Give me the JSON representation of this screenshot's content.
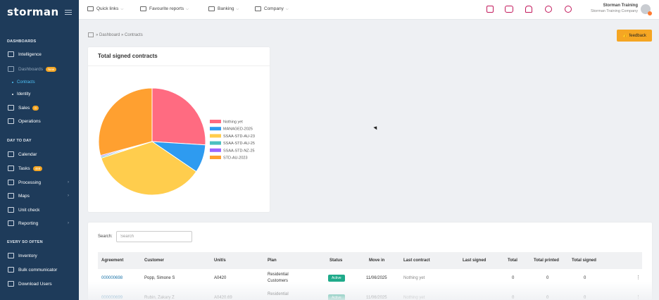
{
  "sidebar": {
    "logo": "storman",
    "sections": {
      "dashboards": "DASHBOARDS",
      "day_to_day": "DAY TO DAY",
      "every_so_often": "EVERY SO OFTEN"
    },
    "items": {
      "intelligence": "Intelligence",
      "dashboards": "Dashboards",
      "dashboards_badge": "New",
      "contracts": "Contracts",
      "identity": "Identity",
      "sales": "Sales",
      "sales_badge": "0",
      "operations": "Operations",
      "calendar": "Calendar",
      "tasks": "Tasks",
      "tasks_badge": "459",
      "processing": "Processing",
      "maps": "Maps",
      "unit_check": "Unit check",
      "reporting": "Reporting",
      "inventory": "Inventory",
      "bulk_communicator": "Bulk communicator",
      "download_users": "Download Users"
    }
  },
  "topbar": {
    "menus": [
      "Quick links",
      "Favourite reports",
      "Banking",
      "Company"
    ],
    "user_name": "Storman Training",
    "user_company": "Storman Training Company"
  },
  "breadcrumb": {
    "dashboard": "Dashboard",
    "contracts": "Contracts"
  },
  "feedback_label": "feedback",
  "chart_card": {
    "title": "Total signed contracts"
  },
  "chart_data": {
    "type": "pie",
    "title": "Total signed contracts",
    "legend_position": "right",
    "slices": [
      {
        "label": "Nothing yet",
        "value": 26.0,
        "color": "#ff6b81"
      },
      {
        "label": "MANAGED-2025",
        "value": 8.5,
        "color": "#2e9bf0"
      },
      {
        "label": "SSAA-STD-AU-23",
        "value": 35.5,
        "color": "#ffcd4d"
      },
      {
        "label": "SSAA-STD-AU-25",
        "value": 0.4,
        "color": "#4bc0c0"
      },
      {
        "label": "SSAA-STD-NZ-25",
        "value": 0.4,
        "color": "#9966ff"
      },
      {
        "label": "STD-AU-2023",
        "value": 29.2,
        "color": "#ffa030"
      }
    ]
  },
  "table": {
    "search_label": "Search:",
    "search_placeholder": "Search",
    "columns": [
      "Agreement",
      "Customer",
      "Unit/s",
      "Plan",
      "Status",
      "Move in",
      "Last contract",
      "Last signed",
      "Total",
      "Total printed",
      "Total signed"
    ],
    "rows": [
      {
        "agreement": "000000698",
        "customer": "Popp, Simone S",
        "units": "A0420",
        "plan_line1": "Residential",
        "plan_line2": "Customers",
        "status": "Active",
        "move_in": "11/06/2025",
        "last_contract": "Nothing yet",
        "last_signed": "",
        "total": "0",
        "total_printed": "0",
        "total_signed": "0"
      },
      {
        "agreement": "000000699",
        "customer": "Rubin, Zakary Z",
        "units": "A0420.69",
        "plan_line1": "Residential",
        "plan_line2": "",
        "status": "Active",
        "move_in": "11/06/2025",
        "last_contract": "Nothing yet",
        "last_signed": "",
        "total": "0",
        "total_printed": "0",
        "total_signed": "0"
      }
    ]
  }
}
